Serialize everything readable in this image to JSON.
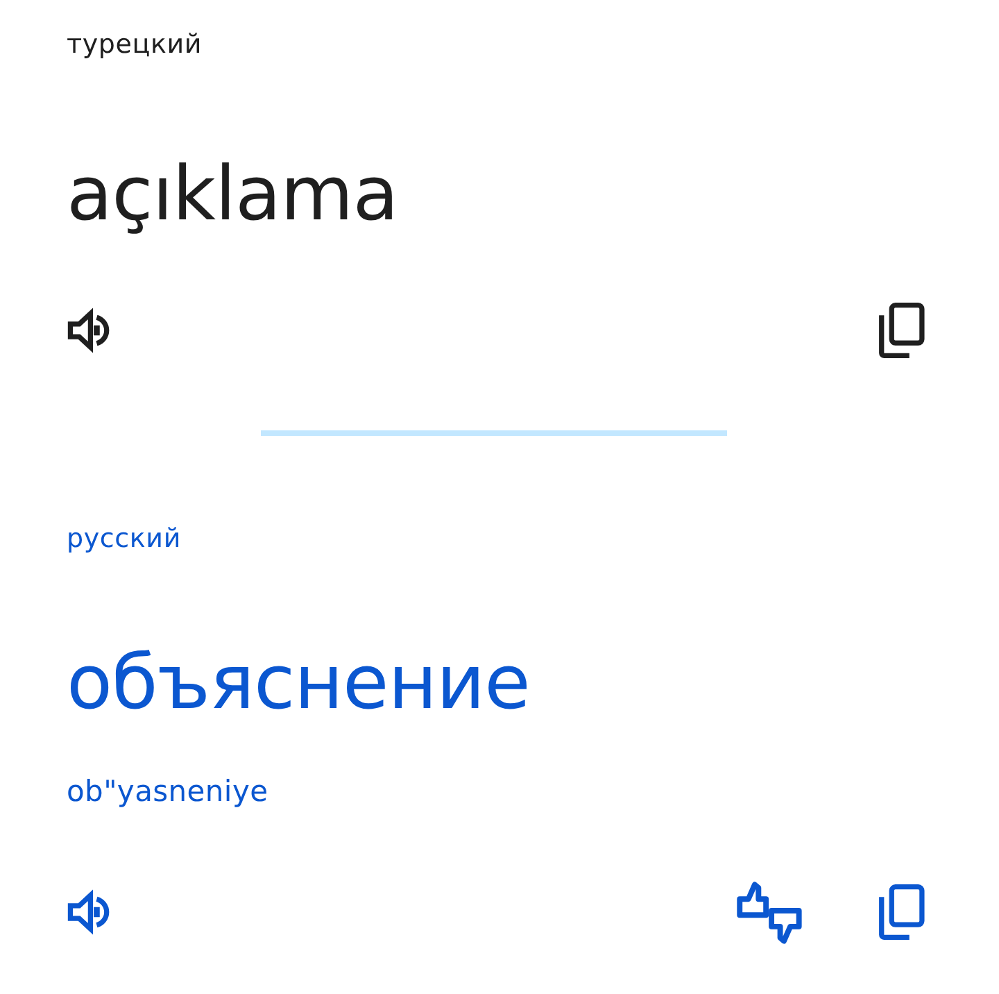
{
  "source": {
    "language": "турецкий",
    "text": "açıklama"
  },
  "target": {
    "language": "русский",
    "text": "объяснение",
    "transliteration": "ob\"yasneniye"
  }
}
